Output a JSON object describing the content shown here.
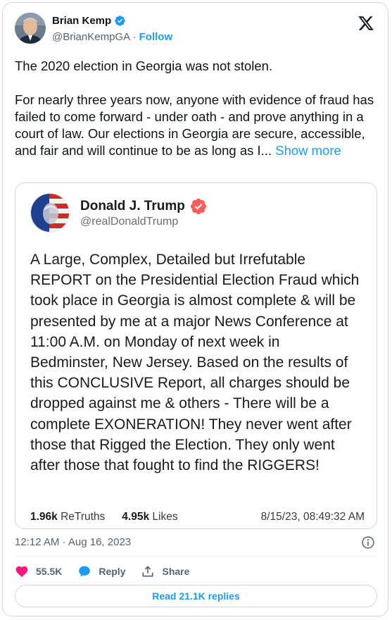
{
  "tweet": {
    "author_name": "Brian Kemp",
    "author_handle": "@BrianKempGA",
    "separator": "·",
    "follow_label": "Follow",
    "text_paragraph_1": "The 2020 election in Georgia was not stolen.",
    "text_paragraph_2": "For nearly three years now, anyone with evidence of fraud has failed to come forward - under oath - and prove anything in a court of law. Our elections in Georgia are secure, accessible, and fair and will continue to be as long as I...",
    "show_more_label": "Show more",
    "timestamp": "12:12 AM · Aug 16, 2023"
  },
  "quote": {
    "author_name": "Donald J. Trump",
    "author_handle": "@realDonaldTrump",
    "text": "A Large, Complex, Detailed but Irrefutable REPORT on the Presidential Election Fraud which took place in Georgia is almost complete & will be presented by me at a major News Conference at 11:00 A.M. on Monday of next week in Bedminster, New Jersey. Based on the results of this CONCLUSIVE Report, all charges should be dropped against me & others - There will be a complete EXONERATION! They never went after those that Rigged the Election. They only went after those that fought to find the RIGGERS!",
    "retruths_count": "1.96k",
    "retruths_label": "ReTruths",
    "likes_count": "4.95k",
    "likes_label": "Likes",
    "date": "8/15/23, 08:49:32 AM"
  },
  "actions": {
    "likes": "55.5K",
    "reply_label": "Reply",
    "share_label": "Share"
  },
  "read_replies_label": "Read 21.1K replies",
  "icons": {
    "verified": "verified-badge-icon",
    "x_logo": "x-logo-icon",
    "info": "info-icon",
    "like": "heart-icon",
    "reply": "reply-bubble-icon",
    "share": "share-upload-icon"
  },
  "colors": {
    "accent": "#1d9bf0",
    "heart": "#f91880",
    "truth_verified": "#ff5c5c",
    "text": "#0f1419",
    "muted": "#536471"
  }
}
